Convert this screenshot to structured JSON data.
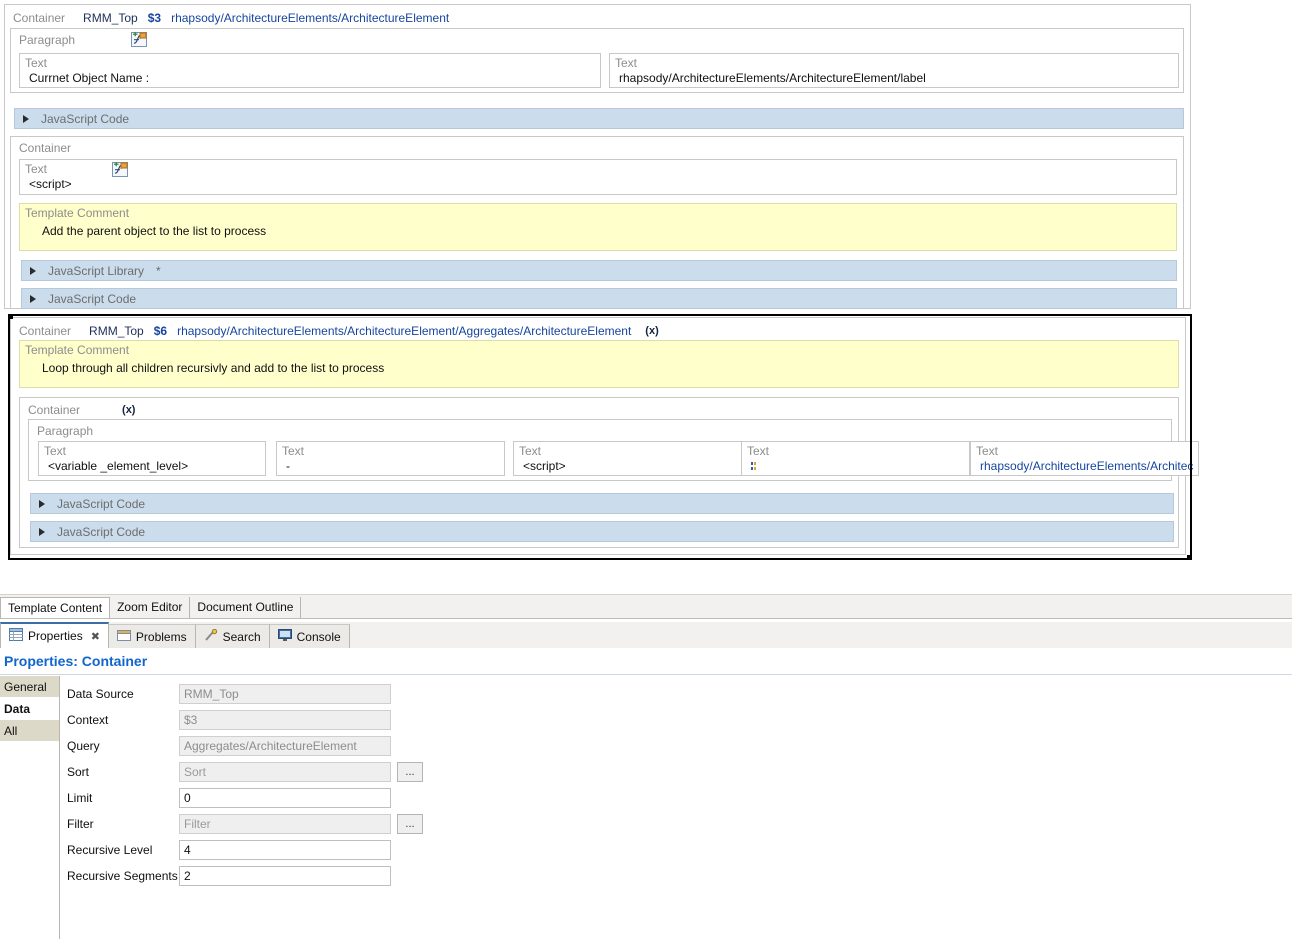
{
  "editor": {
    "outer_container": {
      "type_label": "Container",
      "data_source": "RMM_Top",
      "context": "$3",
      "query": "rhapsody/ArchitectureElements/ArchitectureElement"
    },
    "paragraph1": {
      "type_label": "Paragraph",
      "fx_icon": "fx-formula-icon",
      "texts": [
        {
          "caption": "Text",
          "value": "Currnet Object Name :"
        },
        {
          "caption": "Text",
          "value": "rhapsody/ArchitectureElements/ArchitectureElement/label"
        }
      ]
    },
    "js_bar_1": {
      "label": "JavaScript Code",
      "marker": ""
    },
    "inner_container_1": {
      "type_label": "Container",
      "script_text": {
        "caption": "Text",
        "value": "<script>",
        "fx_icon": "fx-formula-icon"
      },
      "comment": {
        "caption": "Template Comment",
        "value": "Add the parent object to the list to process"
      },
      "js_library_bar": {
        "label": "JavaScript Library",
        "marker": "*"
      },
      "js_code_bar": {
        "label": "JavaScript Code",
        "marker": ""
      }
    },
    "selected_container": {
      "type_label": "Container",
      "data_source": "RMM_Top",
      "context": "$6",
      "query": "rhapsody/ArchitectureElements/ArchitectureElement/Aggregates/ArchitectureElement",
      "recursive_marker": "(x)",
      "comment": {
        "caption": "Template Comment",
        "value": "Loop through all children recursivly and add to the list to process"
      },
      "child_container": {
        "type_label": "Container",
        "recursive_marker": "(x)",
        "paragraph": {
          "type_label": "Paragraph",
          "texts": [
            {
              "caption": "Text",
              "value": "<variable _element_level>"
            },
            {
              "caption": "Text",
              "value": "-"
            },
            {
              "caption": "Text",
              "value": "<script>"
            },
            {
              "caption": "Text",
              "value": "::",
              "is_glyph": true
            },
            {
              "caption": "Text",
              "value": "rhapsody/ArchitectureElements/Architec"
            }
          ]
        },
        "js_bars": [
          {
            "label": "JavaScript Code",
            "marker": ""
          },
          {
            "label": "JavaScript Code",
            "marker": ""
          }
        ]
      }
    }
  },
  "editor_tabs": [
    {
      "label": "Template Content",
      "active": true
    },
    {
      "label": "Zoom Editor",
      "active": false
    },
    {
      "label": "Document Outline",
      "active": false
    }
  ],
  "view_tabs": [
    {
      "label": "Properties",
      "icon": "properties-icon",
      "active": true,
      "close": "✖"
    },
    {
      "label": "Problems",
      "icon": "problems-icon",
      "active": false
    },
    {
      "label": "Search",
      "icon": "search-icon",
      "active": false
    },
    {
      "label": "Console",
      "icon": "console-icon",
      "active": false
    }
  ],
  "properties": {
    "title": "Properties: Container",
    "tabs": [
      {
        "label": "General",
        "active": false
      },
      {
        "label": "Data",
        "active": true
      },
      {
        "label": "All",
        "active": false
      }
    ],
    "fields": [
      {
        "label": "Data Source",
        "value": "RMM_Top",
        "placeholder": "",
        "readonly": true,
        "button": false
      },
      {
        "label": "Context",
        "value": "$3",
        "placeholder": "",
        "readonly": true,
        "button": false
      },
      {
        "label": "Query",
        "value": "Aggregates/ArchitectureElement",
        "placeholder": "",
        "readonly": true,
        "button": false
      },
      {
        "label": "Sort",
        "value": "",
        "placeholder": "Sort",
        "readonly": true,
        "button": true
      },
      {
        "label": "Limit",
        "value": "0",
        "placeholder": "",
        "readonly": false,
        "button": false
      },
      {
        "label": "Filter",
        "value": "",
        "placeholder": "Filter",
        "readonly": true,
        "button": true
      },
      {
        "label": "Recursive Level",
        "value": "4",
        "placeholder": "",
        "readonly": false,
        "button": false
      },
      {
        "label": "Recursive Segments",
        "value": "2",
        "placeholder": "",
        "readonly": false,
        "button": false
      }
    ],
    "button_label": "..."
  },
  "colors": {
    "js_bar": "#cbdcec",
    "comment": "#ffffcc",
    "accent": "#1166cc",
    "link": "#16459e",
    "prop_tab": "#ddd9c8"
  }
}
